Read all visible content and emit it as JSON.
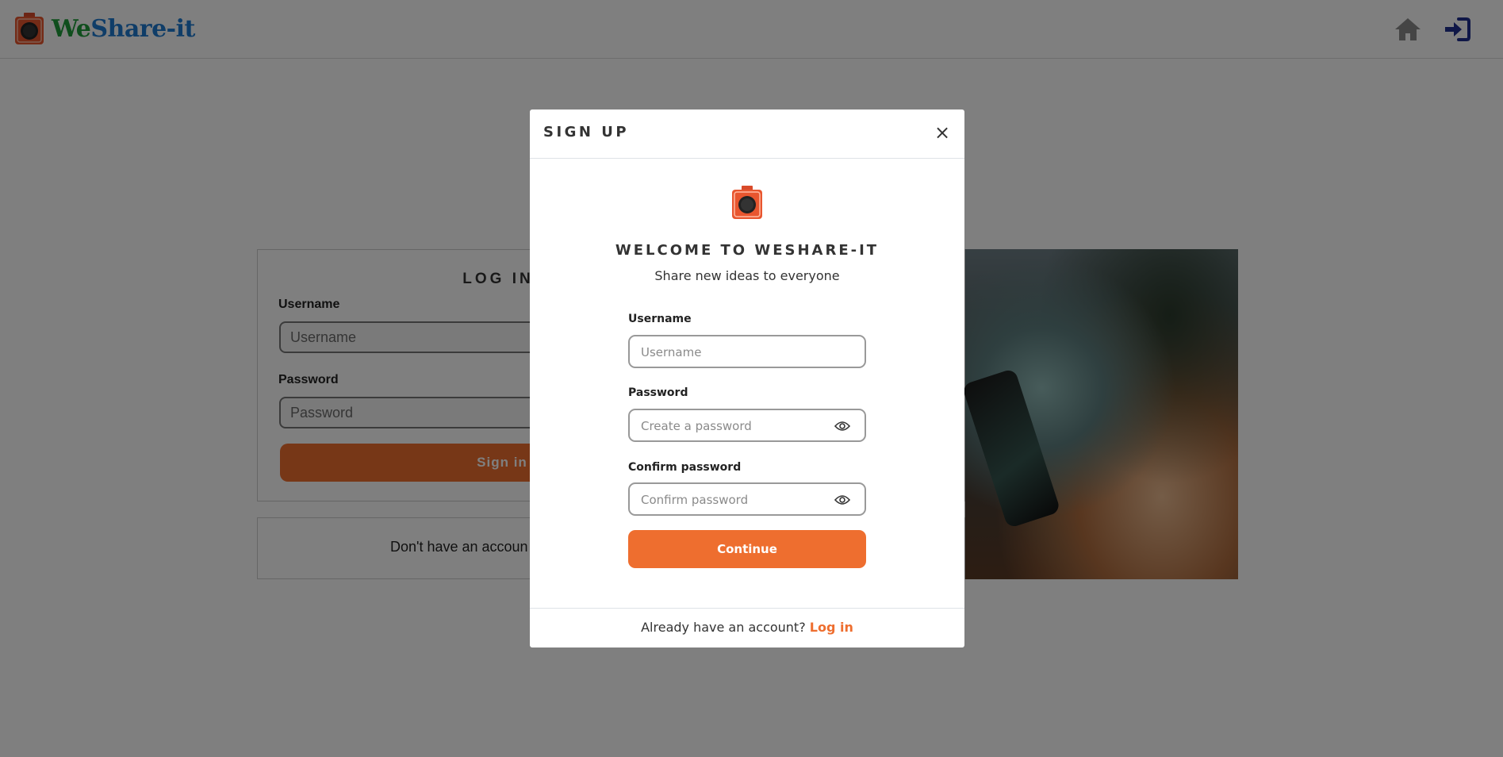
{
  "navbar": {
    "brand_we": "We",
    "brand_rest": "Share-it",
    "home_icon": "home-icon",
    "login_icon": "sign-in-icon",
    "accent_color": "#1f2f8f"
  },
  "background_page": {
    "login_title": "LOG IN",
    "username_label": "Username",
    "username_placeholder": "Username",
    "password_label": "Password",
    "password_placeholder": "Password",
    "sign_in_label": "Sign in",
    "no_account_text": "Don't have an accoun"
  },
  "modal": {
    "title": "SIGN UP",
    "close_symbol": "×",
    "logo_icon": "camera-logo-icon",
    "welcome": "WELCOME TO WESHARE-IT",
    "tagline": "Share new ideas to everyone",
    "username_label": "Username",
    "username_placeholder": "Username",
    "password_label": "Password",
    "password_placeholder": "Create a password",
    "confirm_label": "Confirm password",
    "confirm_placeholder": "Confirm password",
    "continue_label": "Continue",
    "footer_text": "Already have an account?",
    "footer_link": "Log in"
  },
  "colors": {
    "primary_orange": "#ee6e2f",
    "brand_green": "#1f9d3a",
    "brand_blue": "#1f7bd1"
  }
}
